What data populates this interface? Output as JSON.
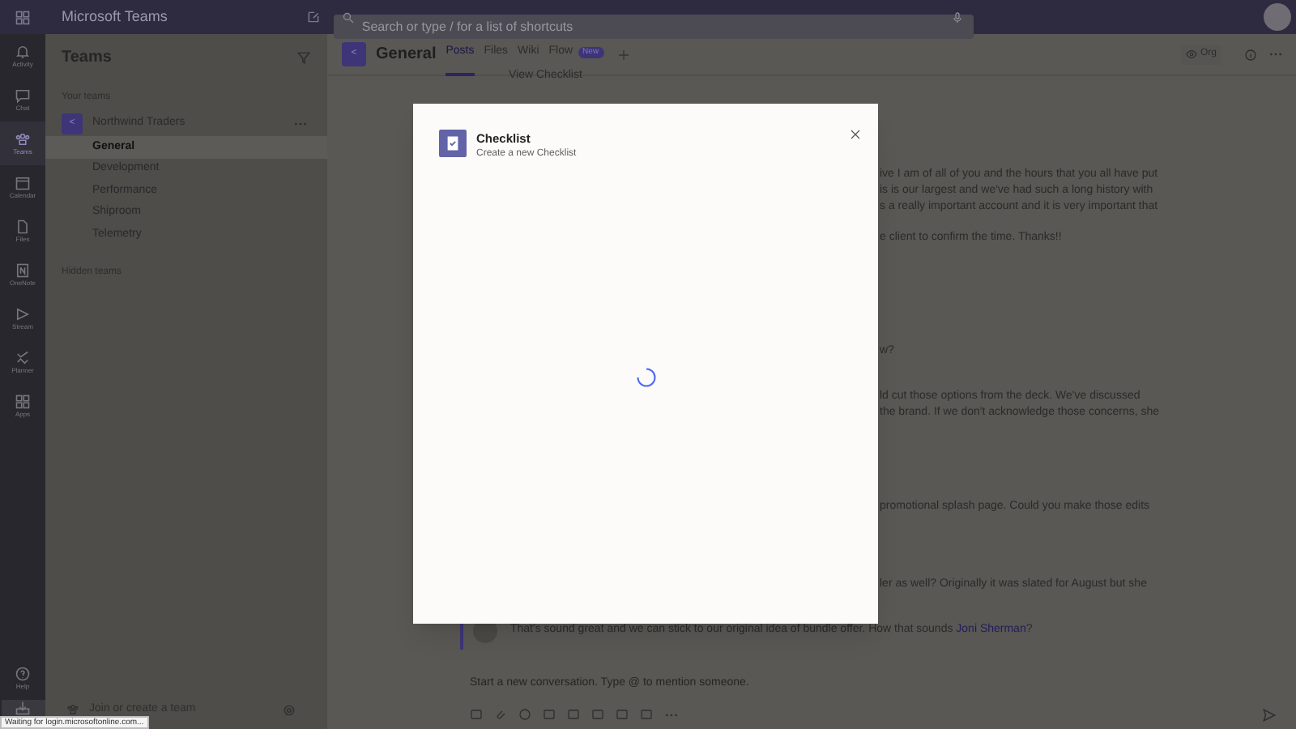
{
  "app_title": "Microsoft Teams",
  "search": {
    "placeholder": "Search or type / for a list of shortcuts"
  },
  "rail": [
    {
      "label": "Activity",
      "selected": false
    },
    {
      "label": "Chat",
      "selected": false
    },
    {
      "label": "Teams",
      "selected": true
    },
    {
      "label": "Calendar",
      "selected": false
    },
    {
      "label": "Files",
      "selected": false
    },
    {
      "label": "OneNote",
      "selected": false
    },
    {
      "label": "Stream",
      "selected": false
    },
    {
      "label": "Planner",
      "selected": false
    },
    {
      "label": "Apps",
      "selected": false
    }
  ],
  "rail_bottom": [
    {
      "label": "Help"
    }
  ],
  "sidebar": {
    "title": "Teams",
    "section": "Your teams",
    "team": {
      "name": "Northwind Traders",
      "initial": "<"
    },
    "channels": [
      {
        "label": "General",
        "selected": true
      },
      {
        "label": "Development",
        "selected": false
      },
      {
        "label": "Performance",
        "selected": false
      },
      {
        "label": "Shiproom",
        "selected": false
      },
      {
        "label": "Telemetry",
        "selected": false
      }
    ],
    "hidden": "Hidden teams",
    "join": "Join or create a team"
  },
  "channel": {
    "initial": "<",
    "name": "General",
    "tabs": [
      {
        "label": "Posts",
        "selected": true
      },
      {
        "label": "Files",
        "selected": false
      },
      {
        "label": "Wiki",
        "selected": false
      },
      {
        "label": "Flow",
        "selected": false,
        "badge": "New"
      }
    ],
    "org": "Org"
  },
  "messages": {
    "top_link": "View Checklist",
    "fragments": [
      "ive I am of all of you and the hours that you all have put",
      "is is our largest and we've had such a long history with",
      "s a really important account and it is very important that",
      "e client to confirm the time. Thanks!!",
      "w?",
      "ld cut those options from the deck. We've discussed",
      "the brand. If we don't acknowledge those concerns, she",
      "promotional splash page. Could you make those edits",
      "ler as well? Originally it was slated for August but she"
    ],
    "last": {
      "text": "That's sound great and we can stick to our original idea of bundle offer. How that sounds ",
      "mention": "Joni Sherman",
      "after": "?"
    }
  },
  "compose": {
    "placeholder": "Start a new conversation. Type @ to mention someone."
  },
  "dialog": {
    "title": "Checklist",
    "subtitle": "Create a new Checklist",
    "loading": true
  },
  "status_bar": "Waiting for login.microsoftonline.com..."
}
